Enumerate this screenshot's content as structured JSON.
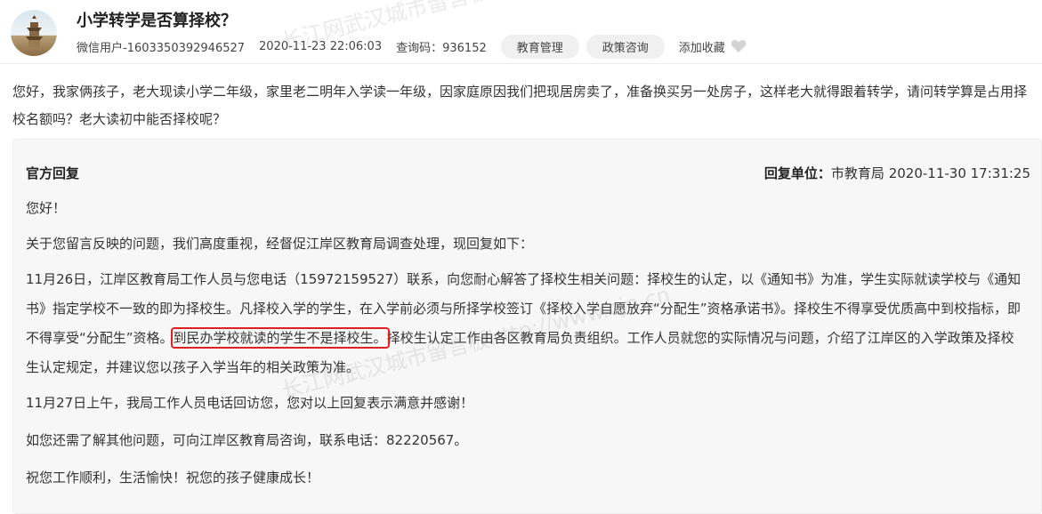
{
  "header": {
    "title": "小学转学是否算择校？",
    "user": "微信用户-1603350392946527",
    "datetime": "2020-11-23 22:06:03",
    "query_code": "查询码：936152",
    "tags": [
      "教育管理",
      "政策咨询"
    ],
    "favorite_label": "添加收藏"
  },
  "question": {
    "text": "您好，我家俩孩子，老大现读小学二年级，家里老二明年入学读一年级，因家庭原因我们把现居房卖了，准备换买另一处房子，这样老大就得跟着转学，请问转学算是占用择校名额吗？老大读初中能否择校呢？"
  },
  "reply": {
    "heading": "官方回复",
    "unit_label": "回复单位：",
    "unit_value": "市教育局 2020-11-30 17:31:25",
    "greeting": "您好！",
    "p1": "关于您留言反映的问题，我们高度重视，经督促江岸区教育局调查处理，现回复如下：",
    "p2_before": "11月26日，江岸区教育局工作人员与您电话（15972159527）联系，向您耐心解答了择校生相关问题：择校生的认定，以《通知书》为准，学生实际就读学校与《通知书》指定学校不一致的即为择校生。凡择校入学的学生，在入学前必须与所择学校签订《择校入学自愿放弃“分配生”资格承诺书》。择校生不得享受优质高中到校指标，即不得享受“分配生”资格。",
    "p2_highlight": "到民办学校就读的学生不是择校生。",
    "p2_after": "择校生认定工作由各区教育局负责组织。工作人员就您的实际情况与问题，介绍了江岸区的入学政策及择校生认定规定，并建议您以孩子入学当年的相关政策为准。",
    "p3": "11月27日上午，我局工作人员电话回访您，您对以上回复表示满意并感谢！",
    "p4": "如您还需了解其他问题，可向江岸区教育局咨询，联系电话：82220567。",
    "p5": "祝您工作顺利，生活愉快！祝您的孩子健康成长！"
  },
  "watermarks": [
    "长江网武汉城市留言板http://www.cjn.cn",
    "长江网武汉城市留言板http://www.cjn.cn"
  ],
  "icons": {
    "favorite": "heart-icon",
    "avatar": "tower-avatar"
  },
  "colors": {
    "highlight_border": "#e02020",
    "reply_bg": "#f7f7f7",
    "pill_bg": "#f0f0f0"
  }
}
